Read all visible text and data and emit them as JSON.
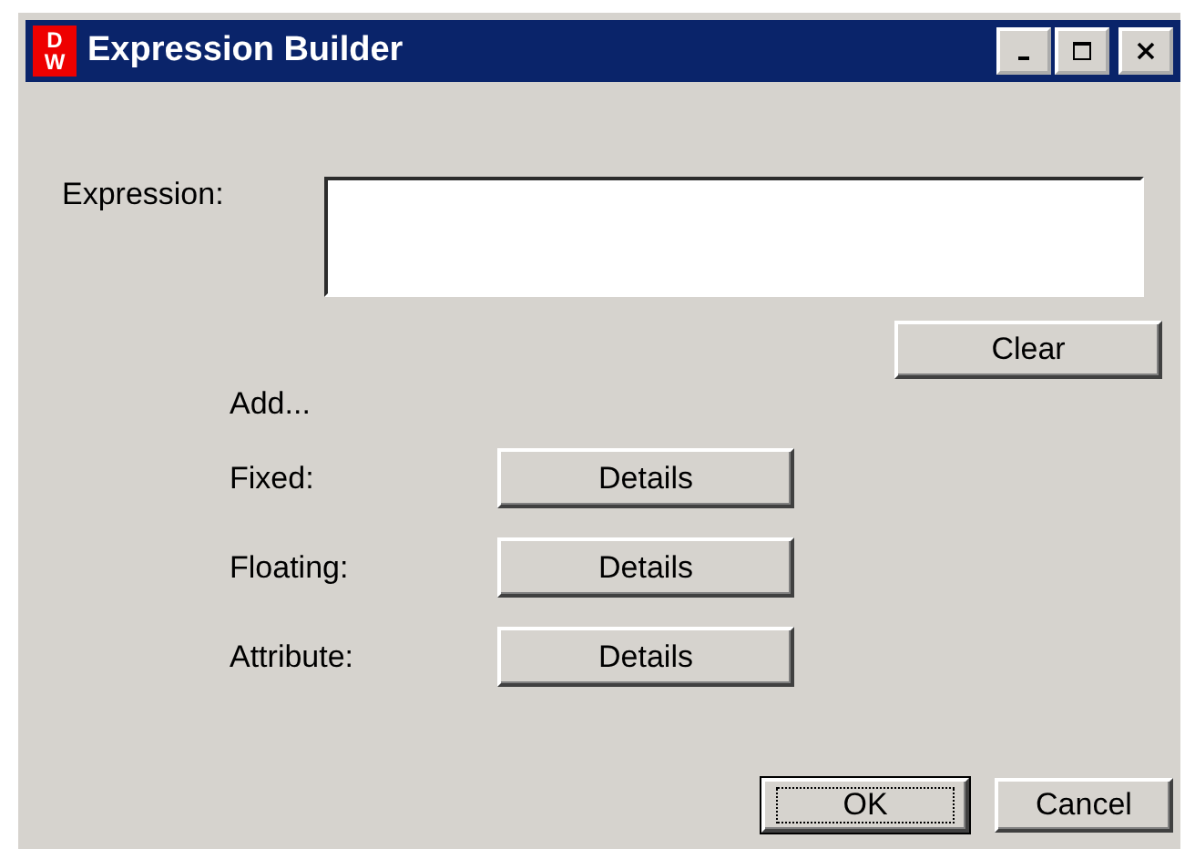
{
  "window": {
    "title": "Expression Builder",
    "logo": {
      "top": "D",
      "bottom": "W"
    }
  },
  "expression": {
    "label": "Expression:",
    "clear_button": "Clear"
  },
  "add_heading": "Add...",
  "rows": [
    {
      "label": "Fixed:",
      "button": "Details"
    },
    {
      "label": "Floating:",
      "button": "Details"
    },
    {
      "label": "Attribute:",
      "button": "Details"
    }
  ],
  "buttons": [
    {
      "label": "OK",
      "default": true
    },
    {
      "label": "Cancel",
      "default": false
    }
  ]
}
